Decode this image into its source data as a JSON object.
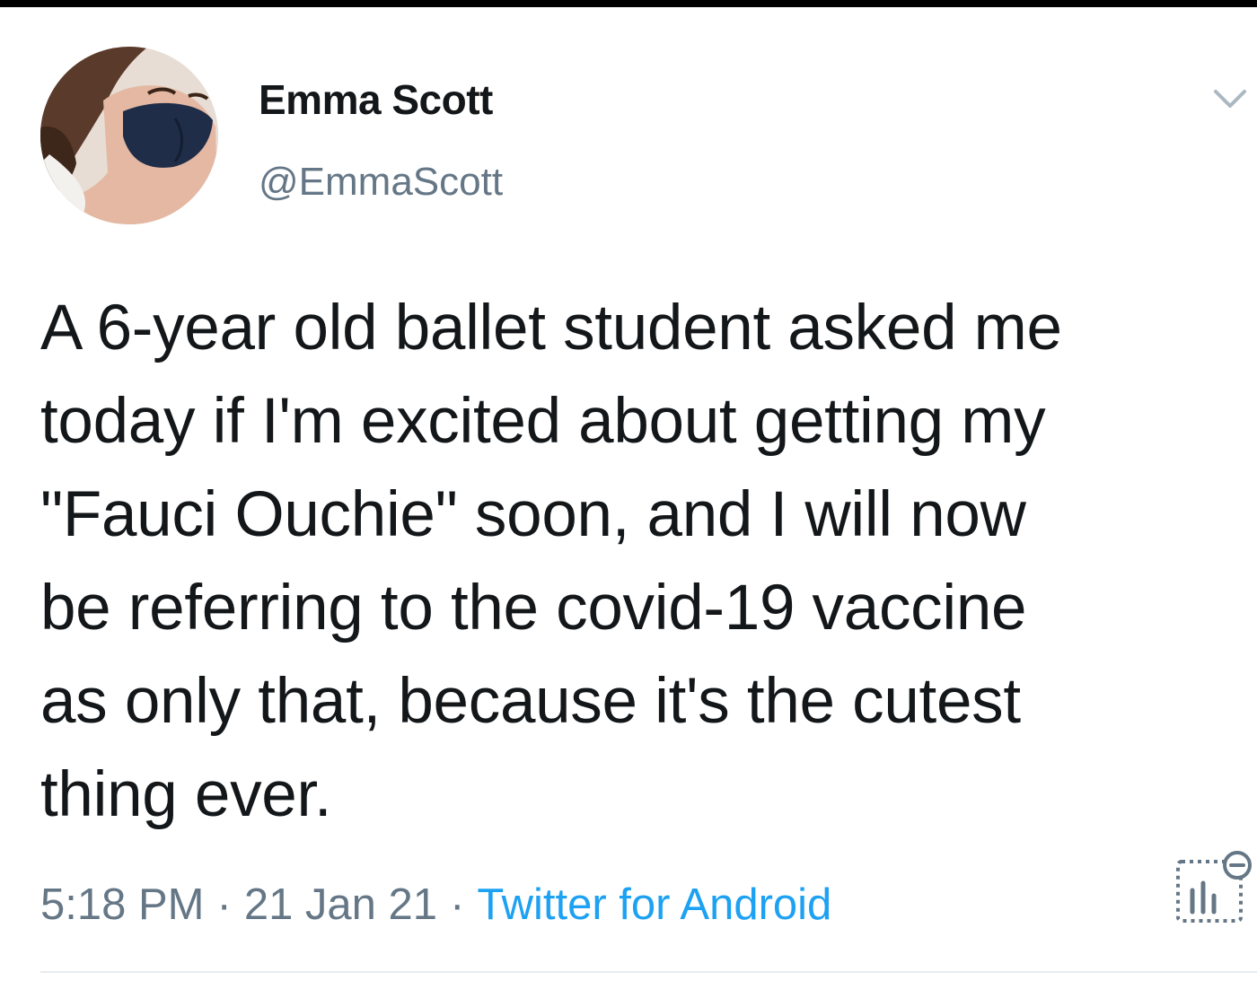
{
  "tweet": {
    "author": {
      "display_name": "Emma Scott",
      "handle": "@EmmaScott"
    },
    "text": "A 6-year old ballet student asked me\ntoday if I'm excited about getting my\n\"Fauci Ouchie\" soon, and I will now\nbe referring to the covid-19 vaccine\nas only that, because it's the cutest\nthing ever.",
    "time": "5:18 PM",
    "date": "21 Jan 21",
    "separator": "·",
    "source": "Twitter for Android"
  },
  "icons": {
    "menu": "chevron-down-icon",
    "analytics": "tweet-analytics-icon"
  },
  "colors": {
    "text": "#14171a",
    "secondary": "#657786",
    "link": "#1da1f2",
    "divider": "#e6ecf0"
  }
}
